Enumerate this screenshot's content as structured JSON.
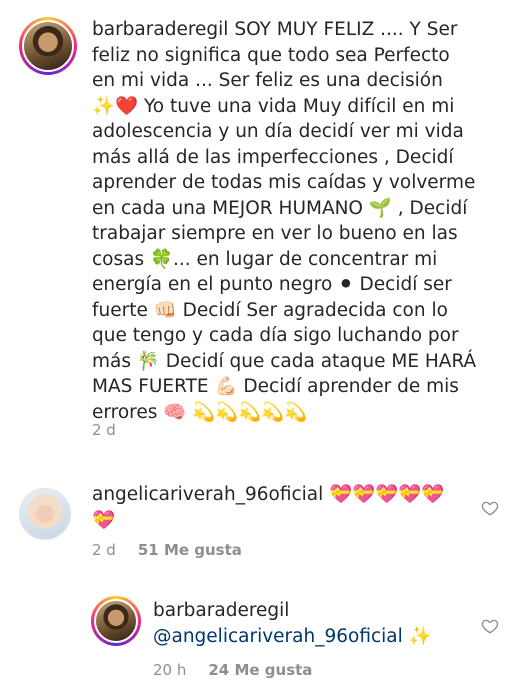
{
  "comments": [
    {
      "username": "barbaraderegil",
      "lines": [
        "SOY MUY FELIZ .... Y Ser",
        "feliz no significa que todo sea Perfecto",
        "en mi vida ... Ser feliz es una decisión",
        "✨❤️ Yo tuve una vida Muy difícil en mi",
        "adolescencia y un día decidí ver mi vida",
        "más allá de las imperfecciones , Decidí",
        "aprender de todas mis caídas y volverme",
        "en cada una MEJOR HUMANO 🌱 , Decidí",
        "trabajar siempre en ver lo bueno en las",
        "cosas 🍀... en lugar de concentrar mi",
        "energía en el punto negro ⚫ Decidí ser",
        "fuerte 👊🏻 Decidí Ser agradecida con lo",
        "que tengo y cada día sigo luchando por",
        "más 🎋 Decidí que cada ataque ME HARÁ",
        "MAS FUERTE 💪🏻 Decidí aprender de mis",
        "errores 🧠 💫💫💫💫💫"
      ],
      "time": "2 d"
    },
    {
      "username": "angelicariverah_96oficial",
      "line1_emojis": "💝💝💝💝💝",
      "line2_emojis": "💝",
      "time": "2 d",
      "likes": "51 Me gusta"
    },
    {
      "username": "barbaraderegil",
      "mention": "@angelicariverah_96oficial",
      "trail": "✨",
      "time": "20 h",
      "likes": "24 Me gusta"
    }
  ],
  "icons": {
    "like": "heart-outline-icon",
    "color_muted": "#8e8e8e"
  }
}
